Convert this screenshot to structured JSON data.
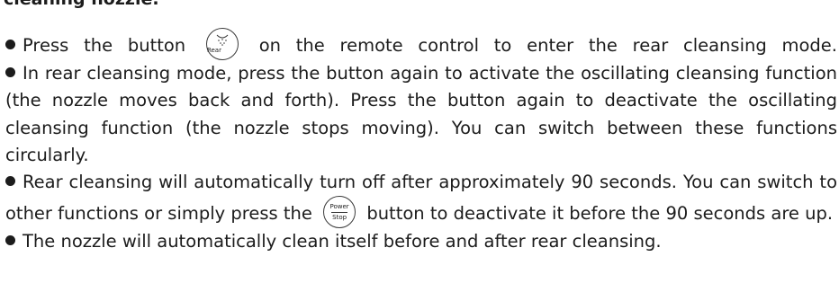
{
  "heading": "cleaning nozzle.",
  "items": [
    {
      "before": "Press the button",
      "after": "on the remote control to enter the rear cleansing mode."
    },
    {
      "text": "In rear cleansing mode, press the button again to activate the oscillating cleansing function (the nozzle moves back and forth). Press the button again to deactivate the oscillating cleansing function (the nozzle stops moving). You can switch between these functions circularly."
    },
    {
      "before": "Rear cleansing will automatically turn off after approximately 90 seconds. You can switch to other functions or simply press the",
      "after": "button to deactivate it before the 90 seconds are up."
    },
    {
      "text": "The nozzle will automatically clean itself before and after rear cleansing."
    }
  ],
  "icons": {
    "rear_label": "Rear",
    "power_label_top": "Power",
    "power_label_bottom": "Stop"
  }
}
